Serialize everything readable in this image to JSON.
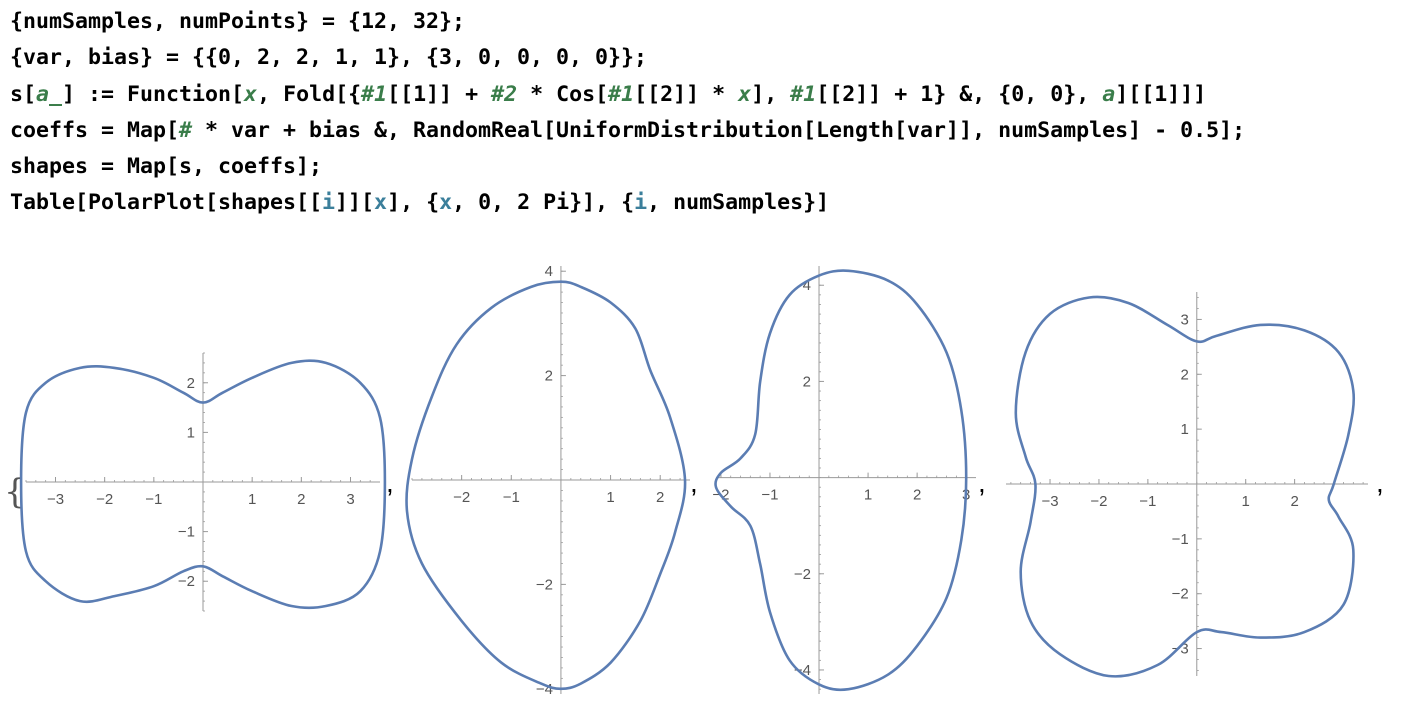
{
  "code": {
    "line1": "{numSamples, numPoints} = {12, 32};",
    "line2": "{var, bias} = {{0, 2, 2, 1, 1}, {3, 0, 0, 0, 0}};",
    "line3": {
      "a": "s[",
      "b": "a_",
      "c": "] := Function[",
      "d": "x",
      "e": ", Fold[{",
      "f": "#1",
      "g": "[[1]] + ",
      "h": "#2",
      "i": " * Cos[",
      "j": "#1",
      "k": "[[2]] * ",
      "l": "x",
      "m": "], ",
      "n": "#1",
      "o": "[[2]] + 1} &, {0, 0}, ",
      "p": "a",
      "q": "][[1]]]"
    },
    "line4": {
      "a": "coeffs = Map[",
      "b": "#",
      "c": " * var + bias &, RandomReal[UniformDistribution[Length[var]], numSamples] - 0.5];"
    },
    "line5": "shapes = Map[s, coeffs];",
    "line6": {
      "a": "Table[PolarPlot[shapes[[",
      "b": "i",
      "c": "]][",
      "d": "x",
      "e": "], {",
      "f": "x",
      "g": ", 0, 2 Pi}], {",
      "h": "i",
      "i": ", numSamples}]"
    }
  },
  "output": {
    "open_brace": "{",
    "separator": ","
  },
  "colors": {
    "curve": "#5b7db3",
    "axis": "#9a9a9a",
    "tick_label": "#555555"
  },
  "chart_data": [
    {
      "type": "line",
      "plot_kind": "polar",
      "xlim": [
        -3.6,
        3.6
      ],
      "ylim": [
        -2.6,
        2.6
      ],
      "x_ticks": [
        "-3",
        "-2",
        "-1",
        "1",
        "2",
        "3"
      ],
      "y_ticks": [
        "-2",
        "-1",
        "1",
        "2"
      ],
      "series": [
        {
          "x": [
            3.7,
            3.6,
            3.2,
            2.5,
            1.8,
            1.0,
            0.4,
            0.0,
            -0.4,
            -1.0,
            -1.8,
            -2.5,
            -3.2,
            -3.6,
            -3.7,
            -3.6,
            -3.2,
            -2.5,
            -1.8,
            -1.0,
            -0.4,
            0.0,
            0.4,
            1.0,
            1.8,
            2.5,
            3.2,
            3.6,
            3.7
          ],
          "y": [
            0.0,
            1.3,
            2.0,
            2.4,
            2.4,
            2.1,
            1.8,
            1.6,
            1.8,
            2.1,
            2.3,
            2.3,
            2.0,
            1.4,
            0.0,
            -1.4,
            -2.0,
            -2.4,
            -2.3,
            -2.1,
            -1.8,
            -1.7,
            -1.9,
            -2.2,
            -2.5,
            -2.5,
            -2.2,
            -1.4,
            0.0
          ]
        }
      ]
    },
    {
      "type": "line",
      "plot_kind": "polar",
      "xlim": [
        -3.0,
        2.6
      ],
      "ylim": [
        -4.1,
        4.1
      ],
      "x_ticks": [
        "-2",
        "-1",
        "1",
        "2"
      ],
      "y_ticks": [
        "-4",
        "-2",
        "2",
        "4"
      ],
      "series": [
        {
          "x": [
            2.5,
            2.2,
            1.8,
            1.5,
            1.0,
            0.4,
            0.0,
            -0.6,
            -1.4,
            -2.1,
            -2.6,
            -3.0,
            -3.1,
            -2.8,
            -2.0,
            -1.2,
            -0.4,
            0.0,
            0.4,
            1.0,
            1.6,
            2.0,
            2.3,
            2.5
          ],
          "y": [
            0.0,
            1.2,
            2.1,
            2.9,
            3.4,
            3.7,
            3.8,
            3.7,
            3.3,
            2.6,
            1.6,
            0.4,
            -0.6,
            -1.6,
            -2.7,
            -3.5,
            -3.9,
            -4.0,
            -3.9,
            -3.5,
            -2.7,
            -1.8,
            -1.0,
            0.0
          ]
        }
      ]
    },
    {
      "type": "line",
      "plot_kind": "polar",
      "xlim": [
        -2.1,
        3.2
      ],
      "ylim": [
        -4.5,
        4.4
      ],
      "x_ticks": [
        "-2",
        "-1",
        "1",
        "2",
        "3"
      ],
      "y_ticks": [
        "-4",
        "-2",
        "2",
        "4"
      ],
      "series": [
        {
          "x": [
            3.0,
            2.9,
            2.6,
            2.0,
            1.4,
            0.6,
            0.0,
            -0.6,
            -1.0,
            -1.2,
            -1.3,
            -1.6,
            -2.0,
            -2.1,
            -1.8,
            -1.4,
            -1.2,
            -1.0,
            -0.6,
            0.0,
            0.6,
            1.4,
            2.0,
            2.6,
            2.9,
            3.0
          ],
          "y": [
            0.0,
            1.4,
            2.6,
            3.6,
            4.1,
            4.3,
            4.2,
            3.8,
            3.0,
            2.0,
            0.9,
            0.4,
            0.1,
            -0.2,
            -0.6,
            -1.0,
            -1.8,
            -2.8,
            -3.8,
            -4.3,
            -4.4,
            -4.1,
            -3.5,
            -2.5,
            -1.3,
            0.0
          ]
        }
      ]
    },
    {
      "type": "line",
      "plot_kind": "polar",
      "xlim": [
        -3.9,
        3.5
      ],
      "ylim": [
        -3.5,
        3.5
      ],
      "x_ticks": [
        "-3",
        "-2",
        "-1",
        "1",
        "2"
      ],
      "y_ticks": [
        "-3",
        "-2",
        "-1",
        "1",
        "2",
        "3"
      ],
      "series": [
        {
          "x": [
            2.8,
            3.1,
            3.2,
            2.9,
            2.2,
            1.3,
            0.4,
            0.0,
            -0.6,
            -1.4,
            -2.2,
            -3.0,
            -3.5,
            -3.7,
            -3.5,
            -3.3,
            -3.4,
            -3.6,
            -3.4,
            -2.8,
            -1.8,
            -0.8,
            0.0,
            0.5,
            1.3,
            2.2,
            3.0,
            3.2,
            2.9,
            2.7,
            2.8
          ],
          "y": [
            0.0,
            0.9,
            1.7,
            2.4,
            2.8,
            2.9,
            2.7,
            2.6,
            2.9,
            3.3,
            3.4,
            3.1,
            2.4,
            1.3,
            0.5,
            0.0,
            -0.7,
            -1.6,
            -2.5,
            -3.1,
            -3.5,
            -3.3,
            -2.7,
            -2.7,
            -2.8,
            -2.7,
            -2.2,
            -1.2,
            -0.6,
            -0.3,
            0.0
          ]
        }
      ]
    }
  ]
}
